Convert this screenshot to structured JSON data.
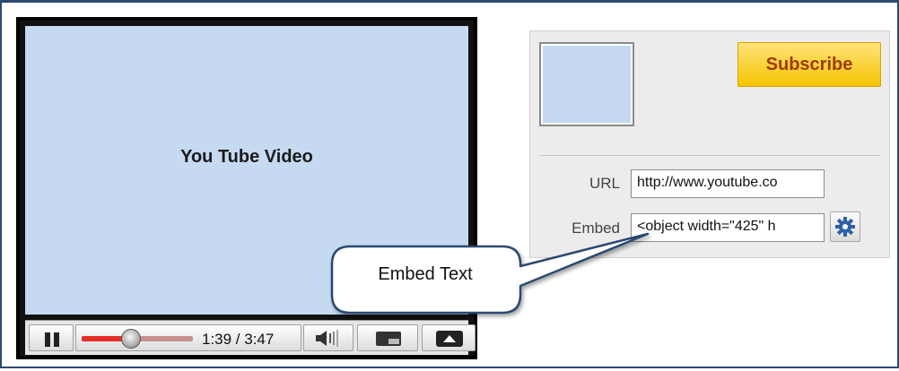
{
  "video": {
    "title": "You Tube Video",
    "time_display": "1:39 / 3:47",
    "progress_fraction": 0.44
  },
  "channel_panel": {
    "subscribe_label": "Subscribe",
    "url_label": "URL",
    "url_value": "http://www.youtube.co",
    "embed_label": "Embed",
    "embed_value": "<object width=\"425\" h"
  },
  "callout": {
    "text": "Embed Text"
  },
  "icons": {
    "pause": "pause-icon",
    "volume": "volume-icon",
    "expand": "expand-icon",
    "fullscreen": "fullscreen-icon",
    "settings": "gear-icon"
  },
  "colors": {
    "video_background": "#c5d9f1",
    "subscribe_background": "#f5c400",
    "subscribe_text": "#a03a00",
    "seek_played": "#e52d27",
    "gear_blue": "#2f62a8",
    "frame_border": "#2b4a72",
    "callout_border": "#2b4a72"
  }
}
